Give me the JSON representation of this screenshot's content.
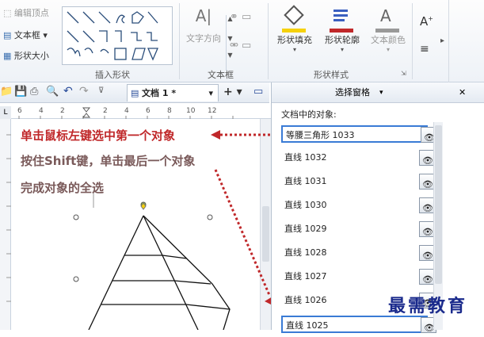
{
  "ribbon": {
    "left_items": [
      "编辑顶点",
      "文本框",
      "形状大小"
    ],
    "groups": {
      "insert_shape": "插入形状",
      "textbox": "文本框",
      "shape_style": "形状样式"
    },
    "text_direction": "文字方向",
    "fill": "形状填充",
    "outline": "形状轮廓",
    "text_color": "文本颜色",
    "font_grow": "A"
  },
  "document": {
    "tab_label": "文档 1 *",
    "ruler_numbers": [
      "6",
      "4",
      "2",
      "",
      "2",
      "4",
      "6",
      "8",
      "10",
      "12"
    ]
  },
  "panel": {
    "title": "选择窗格",
    "section_label": "文档中的对象:",
    "objects": [
      "等腰三角形 1033",
      "直线 1032",
      "直线 1031",
      "直线 1030",
      "直线 1029",
      "直线 1028",
      "直线 1027",
      "直线 1026",
      "直线 1025"
    ]
  },
  "annotations": {
    "line1": "单击鼠标左键选中第一个对象",
    "line2": "按住Shift键，单击最后一个对象",
    "line3": "完成对象的全选"
  },
  "watermark": "最需教育",
  "colors": {
    "annotation_red": "#c0282a",
    "annotation_gray": "#7a5a5a",
    "selection_border": "#3a7bd5",
    "watermark_blue": "#1a2a8c"
  }
}
